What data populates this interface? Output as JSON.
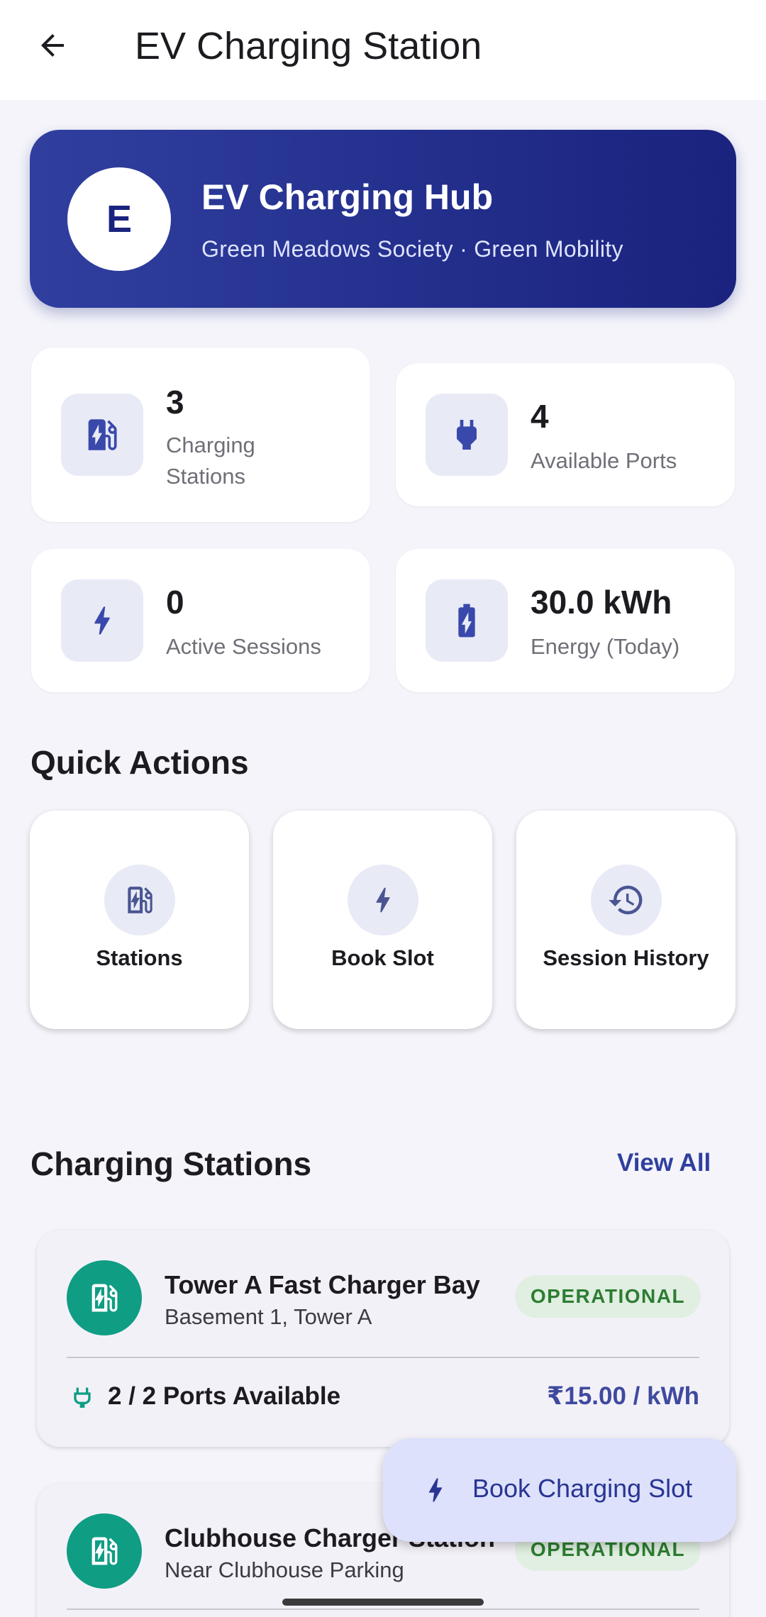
{
  "appbar": {
    "title": "EV Charging Station"
  },
  "hub": {
    "avatar_letter": "E",
    "title": "EV Charging Hub",
    "subtitle": "Green Meadows Society · Green Mobility"
  },
  "stats": [
    {
      "value": "3",
      "label": "Charging Stations",
      "icon": "ev-station-icon"
    },
    {
      "value": "4",
      "label": "Available Ports",
      "icon": "power-plug-icon"
    },
    {
      "value": "0",
      "label": "Active Sessions",
      "icon": "bolt-icon"
    },
    {
      "value": "30.0 kWh",
      "label": "Energy (Today)",
      "icon": "battery-charging-icon"
    }
  ],
  "quick_actions": {
    "title": "Quick Actions",
    "items": [
      {
        "label": "Stations",
        "icon": "ev-station-icon"
      },
      {
        "label": "Book Slot",
        "icon": "bolt-icon"
      },
      {
        "label": "Session History",
        "icon": "history-icon"
      }
    ]
  },
  "stations_section": {
    "title": "Charging Stations",
    "view_all": "View All",
    "items": [
      {
        "name": "Tower A Fast Charger Bay",
        "location": "Basement 1, Tower A",
        "status": "OPERATIONAL",
        "ports": "2 / 2 Ports Available",
        "rate": "₹15.00 / kWh"
      },
      {
        "name": "Clubhouse Charger Station",
        "location": "Near Clubhouse Parking",
        "status": "OPERATIONAL"
      }
    ]
  },
  "fab": {
    "label": "Book Charging Slot"
  },
  "colors": {
    "primary": "#1a237e",
    "accent": "#303f9f",
    "station_icon_bg": "#0f9d84",
    "status_green": "#2e7d32"
  }
}
